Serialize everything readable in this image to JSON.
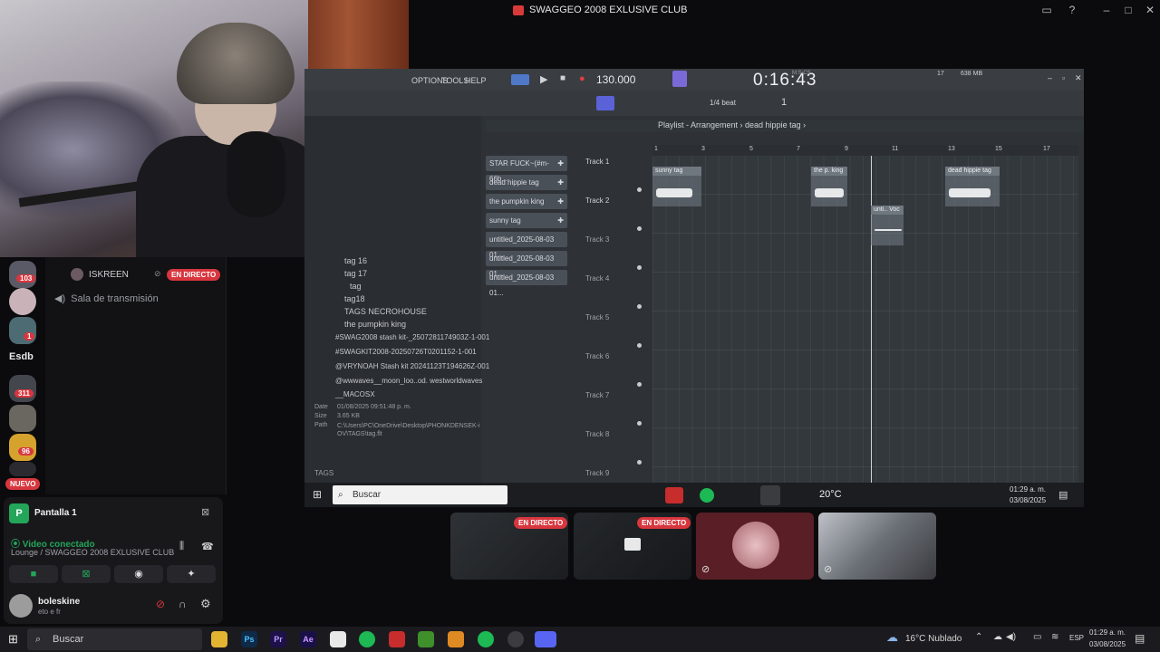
{
  "window": {
    "title": "SWAGGEO 2008 EXLUSIVE CLUB"
  },
  "server_list": {
    "badges": [
      "103",
      "1",
      "311",
      "96"
    ],
    "text_icon": "Esdb",
    "new_label": "NUEVO"
  },
  "channels": {
    "users": [
      {
        "name": "ISKREEN",
        "status": "EN DIRECTO"
      }
    ],
    "stage_channel": "Sala de transmisión"
  },
  "screen_share_tile": {
    "label": "Pantalla 1"
  },
  "voice": {
    "status": "Video conectado",
    "location": "Lounge / SWAGGEO 2008 EXLUSIVE CLUB",
    "username": "boleskine",
    "user_status": "eto e fr"
  },
  "fl_studio": {
    "menu": [
      "OPTIONS",
      "TOOLS",
      "HELP"
    ],
    "tempo": "130.000",
    "time": "0:16:43",
    "time_label": "M:S:CS",
    "snap": "1/4 beat",
    "pattern_number": "1",
    "memory": "638 MB",
    "cpu": "17",
    "playlist_breadcrumb": "Playlist - Arrangement › dead hippie tag ›",
    "browser_items": [
      "tag 16",
      "tag 17",
      "tag",
      "tag18",
      "TAGS NECROHOUSE",
      "the pumpkin king",
      "#SWAG2008 stash kit-_2507281174903Z-1-001",
      "#SWAGKIT2008-20250726T0201152-1-001",
      "@VRYNOAH Stash kit 20241123T194626Z-001",
      "@wwwaves__moon_loo..od. westworldwaves",
      "__MACOSX"
    ],
    "file_info": {
      "date_label": "Date",
      "date": "01/08/2025 09:51:48 p. m.",
      "size_label": "Size",
      "size": "3.65 KB",
      "path_label": "Path",
      "path": "C:\\Users\\PC\\OneDrive\\Desktop\\PHONKDENSEK-iOV\\TAGS\\tag.flt"
    },
    "tags_label": "TAGS",
    "picker": [
      "STAR FUCK~(#m-66b...",
      "dead hippie tag",
      "the pumpkin king",
      "sunny tag",
      "untitled_2025-08-03 01...",
      "untitled_2025-08-03 01...",
      "untitled_2025-08-03 01..."
    ],
    "tracks": [
      "Track 1",
      "Track 2",
      "Track 3",
      "Track 4",
      "Track 5",
      "Track 6",
      "Track 7",
      "Track 8",
      "Track 9"
    ],
    "ruler": [
      "1",
      "3",
      "5",
      "7",
      "9",
      "11",
      "13",
      "15",
      "17"
    ],
    "clips": [
      {
        "label": "sunny tag"
      },
      {
        "label": "the p. king"
      },
      {
        "label": "dead hippie tag"
      },
      {
        "label": "unti.. Voc"
      }
    ]
  },
  "remote_taskbar": {
    "search": "Buscar",
    "weather": "20°C",
    "time": "01:29 a. m.",
    "date": "03/08/2025"
  },
  "stream_thumbs": [
    {
      "badge": "EN DIRECTO"
    },
    {
      "badge": "EN DIRECTO"
    }
  ],
  "taskbar": {
    "search": "Buscar",
    "apps": [
      "Ps",
      "Pr",
      "Ae"
    ],
    "weather": "16°C  Nublado",
    "lang": "ESP",
    "time": "01:29 a. m.",
    "date": "03/08/2025"
  },
  "colors": {
    "live_red": "#d8363e",
    "voice_green": "#23a55a",
    "discord_bg": "#121214"
  }
}
